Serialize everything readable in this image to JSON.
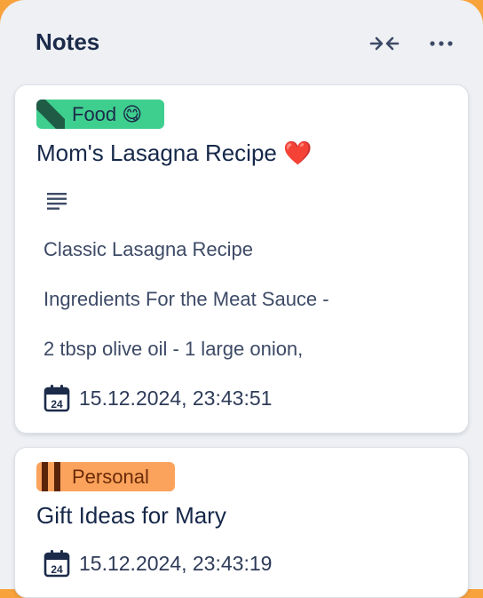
{
  "panel": {
    "title": "Notes",
    "collapse_icon": "collapse-arrows-icon",
    "more_icon": "more-horizontal-icon"
  },
  "notes": [
    {
      "tag": {
        "label": "Food 😋",
        "color": "#3ecf8e",
        "stripe_color": "#1f5b45"
      },
      "title": "Mom's Lasagna Recipe ❤️",
      "content_icon": "text-lines-icon",
      "content_lines": [
        "Classic Lasagna Recipe",
        "Ingredients For the Meat Sauce -",
        "2 tbsp olive oil - 1 large onion,"
      ],
      "date": "15.12.2024, 23:43:51",
      "date_icon": "calendar-icon",
      "date_icon_label": "24"
    },
    {
      "tag": {
        "label": "Personal",
        "color": "#fba35c",
        "stripe_color": "#5a2408"
      },
      "title": "Gift Ideas for Mary",
      "date": "15.12.2024, 23:43:19",
      "date_icon": "calendar-icon",
      "date_icon_label": "24"
    }
  ],
  "colors": {
    "background": "#eef0f4",
    "accent": "#f8a23b",
    "title_text": "#1c2b4a"
  }
}
